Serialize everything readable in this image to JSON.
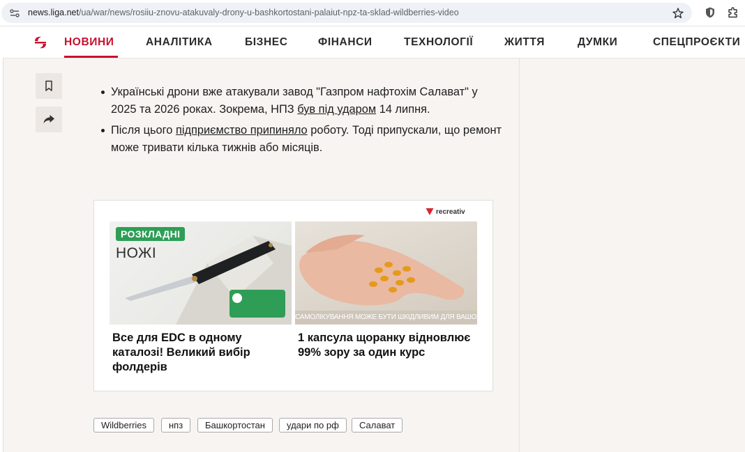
{
  "browser": {
    "url_domain": "news.liga.net",
    "url_path": "/ua/war/news/rosiiu-znovu-atakuvaly-drony-u-bashkortostani-palaiut-npz-ta-sklad-wildberries-video"
  },
  "nav": {
    "items": [
      {
        "label": "НОВИНИ",
        "active": true
      },
      {
        "label": "АНАЛІТИКА"
      },
      {
        "label": "БІЗНЕС"
      },
      {
        "label": "ФІНАНСИ"
      },
      {
        "label": "ТЕХНОЛОГІЇ"
      },
      {
        "label": "ЖИТТЯ"
      },
      {
        "label": "ДУМКИ"
      },
      {
        "label": "СПЕЦПРОЄКТИ"
      }
    ]
  },
  "article": {
    "bullet1": {
      "part1": "Українські дрони вже атакували завод \"Газпром нафтохім Салават\" у 2025 та 2026 роках. Зокрема, НПЗ ",
      "link": "був під ударом",
      "part2": " 14 липня."
    },
    "bullet2": {
      "part1": "Після цього ",
      "link": "підприємство припиняло",
      "part2": " роботу. Тоді припускали, що ремонт може тривати кілька тижнів або місяців."
    }
  },
  "ad": {
    "brand": "recreativ",
    "cards": [
      {
        "badge": "РОЗКЛАДНІ",
        "image_text": "НОЖІ",
        "title": "Все для EDC в одному каталозі! Великий вибір фолдерів"
      },
      {
        "caption": "САМОЛІКУВАННЯ МОЖЕ БУТИ ШКІДЛИВИМ ДЛЯ ВАШОГО ЗДОРОВ'Я",
        "title": "1 капсула щоранку відновлює 99% зору за один курс"
      }
    ]
  },
  "tags": [
    "Wildberries",
    "нпз",
    "Башкортостан",
    "удари по рф",
    "Салават"
  ],
  "colors": {
    "accent": "#c8102e",
    "page_bg": "#f8f4f1",
    "badge_green": "#2e9e56"
  }
}
